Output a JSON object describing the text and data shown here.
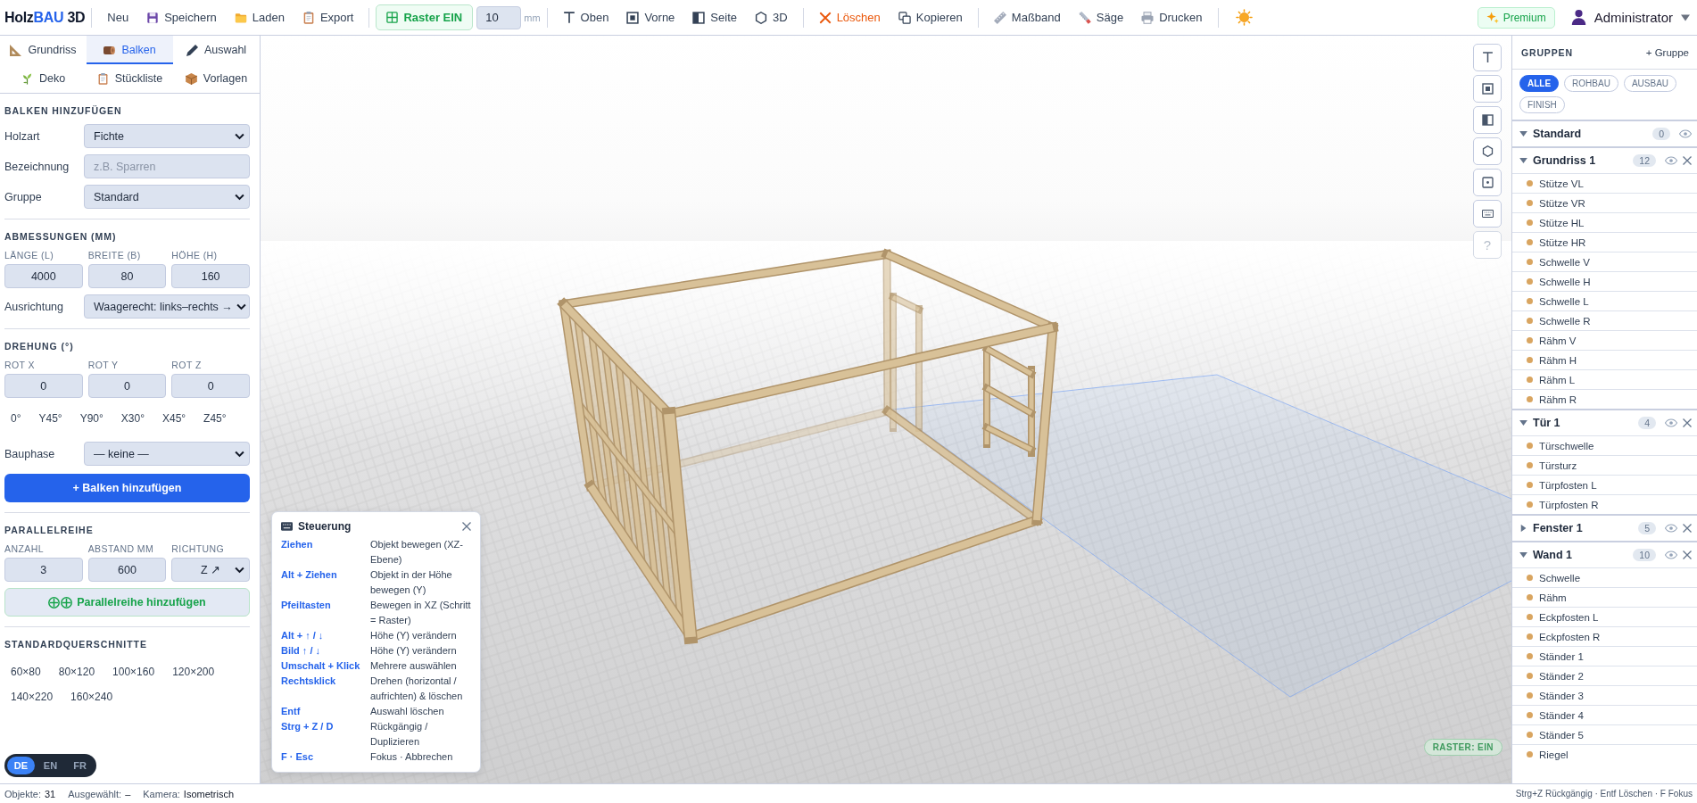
{
  "toolbar": {
    "logo": [
      {
        "text": "Holz",
        "kind": "plain"
      },
      {
        "text": "BAU",
        "kind": "accent"
      },
      {
        "text": " 3D",
        "kind": "plain"
      }
    ],
    "file_actions": [
      {
        "label": "Neu"
      },
      {
        "label": "Speichern"
      },
      {
        "label": "Laden"
      },
      {
        "label": "Export"
      }
    ],
    "grid": {
      "label": "Raster EIN",
      "on": true,
      "value": "10",
      "unit": "mm"
    },
    "views": [
      {
        "label": "Oben"
      },
      {
        "label": "Vorne"
      },
      {
        "label": "Seite"
      },
      {
        "label": "3D"
      }
    ],
    "edit_actions": [
      {
        "label": "Löschen",
        "kind": "danger"
      },
      {
        "label": "Kopieren",
        "kind": "normal"
      }
    ],
    "tools": [
      {
        "label": "Maßband"
      },
      {
        "label": "Säge"
      },
      {
        "label": "Drucken"
      }
    ],
    "premium": "Premium",
    "user": "Administrator"
  },
  "sidebar": {
    "tabs": [
      {
        "label": "Grundriss",
        "selected": false
      },
      {
        "label": "Balken",
        "selected": true
      },
      {
        "label": "Auswahl",
        "selected": false
      },
      {
        "label": "Deko",
        "selected": false
      },
      {
        "label": "Stückliste",
        "selected": false
      },
      {
        "label": "Vorlagen",
        "selected": false
      }
    ],
    "sections": [
      {
        "title": "BALKEN HINZUFÜGEN",
        "rows": [
          {
            "kind": "select",
            "label": "Holzart",
            "value": "Fichte"
          },
          {
            "kind": "text",
            "label": "Bezeichnung",
            "placeholder": "z.B. Sparren"
          },
          {
            "kind": "select",
            "label": "Gruppe",
            "value": "Standard"
          }
        ]
      },
      {
        "title": "ABMESSUNGEN (MM)",
        "rows": [
          {
            "kind": "triple",
            "fields": [
              {
                "label": "LÄNGE (L)",
                "kind": "number",
                "value": "4000"
              },
              {
                "label": "BREITE (B)",
                "kind": "number",
                "value": "80"
              },
              {
                "label": "HÖHE (H)",
                "kind": "number",
                "value": "160"
              }
            ]
          },
          {
            "kind": "select",
            "label": "Ausrichtung",
            "value": "Waagerecht: links–rechts →"
          }
        ]
      },
      {
        "title": "DREHUNG (°)",
        "rows": [
          {
            "kind": "triple",
            "fields": [
              {
                "label": "ROT X",
                "kind": "number",
                "value": "0"
              },
              {
                "label": "ROT Y",
                "kind": "number",
                "value": "0"
              },
              {
                "label": "ROT Z",
                "kind": "number",
                "value": "0"
              }
            ]
          },
          {
            "kind": "presets",
            "items": [
              "0°",
              "Y45°",
              "Y90°",
              "X30°",
              "X45°",
              "Z45°"
            ]
          },
          {
            "kind": "select",
            "label": "Bauphase",
            "value": "— keine —"
          },
          {
            "kind": "primary_button",
            "label": "+ Balken hinzufügen"
          }
        ]
      },
      {
        "title": "PARALLELREIHE",
        "rows": [
          {
            "kind": "triple",
            "fields": [
              {
                "label": "ANZAHL",
                "kind": "number",
                "value": "3"
              },
              {
                "label": "ABSTAND MM",
                "kind": "number",
                "value": "600"
              },
              {
                "label": "RICHTUNG",
                "kind": "select",
                "value": "Z ↗"
              }
            ]
          },
          {
            "kind": "secondary_button",
            "label": "Parallelreihe hinzufügen"
          }
        ]
      },
      {
        "title": "STANDARDQUERSCHNITTE",
        "rows": [
          {
            "kind": "presets",
            "items": [
              "60×80",
              "80×120",
              "100×160",
              "120×200",
              "140×220",
              "160×240"
            ]
          }
        ]
      }
    ],
    "languages": [
      {
        "label": "DE",
        "selected": true
      },
      {
        "label": "EN",
        "selected": false
      },
      {
        "label": "FR",
        "selected": false
      }
    ]
  },
  "scene": {
    "help_button": "?",
    "grid_badge": "RASTER: EIN",
    "controls_help": {
      "title": "Steuerung",
      "rows": [
        {
          "key": "Ziehen",
          "action": "Objekt bewegen (XZ-Ebene)"
        },
        {
          "key": "Alt + Ziehen",
          "action": "Objekt in der Höhe bewegen (Y)"
        },
        {
          "key": "Pfeiltasten",
          "action": "Bewegen in XZ (Schritt = Raster)"
        },
        {
          "key": "Alt + ↑ / ↓",
          "action": "Höhe (Y) verändern"
        },
        {
          "key": "Bild ↑ / ↓",
          "action": "Höhe (Y) verändern"
        },
        {
          "key": "Umschalt + Klick",
          "action": "Mehrere auswählen"
        },
        {
          "key": "Rechtsklick",
          "action": "Drehen (horizontal / aufrichten) & löschen"
        },
        {
          "key": "Entf",
          "action": "Auswahl löschen"
        },
        {
          "key": "Strg + Z / D",
          "action": "Rückgängig / Duplizieren"
        },
        {
          "key": "F · Esc",
          "action": "Fokus · Abbrechen"
        }
      ]
    }
  },
  "groups": {
    "title": "GRUPPEN",
    "add": "+ Gruppe",
    "filters": [
      {
        "label": "ALLE",
        "selected": true
      },
      {
        "label": "ROHBAU",
        "selected": false
      },
      {
        "label": "AUSBAU",
        "selected": false
      },
      {
        "label": "FINISH",
        "selected": false
      }
    ],
    "list": [
      {
        "name": "Standard",
        "count": "0",
        "expanded": true,
        "deletable": false
      },
      {
        "name": "Grundriss 1",
        "count": "12",
        "expanded": true,
        "deletable": true,
        "items": [
          "Stütze VL",
          "Stütze VR",
          "Stütze HL",
          "Stütze HR",
          "Schwelle V",
          "Schwelle H",
          "Schwelle L",
          "Schwelle R",
          "Rähm V",
          "Rähm H",
          "Rähm L",
          "Rähm R"
        ]
      },
      {
        "name": "Tür 1",
        "count": "4",
        "expanded": true,
        "deletable": true,
        "items": [
          "Türschwelle",
          "Türsturz",
          "Türpfosten L",
          "Türpfosten R"
        ]
      },
      {
        "name": "Fenster 1",
        "count": "5",
        "expanded": false,
        "deletable": true
      },
      {
        "name": "Wand 1",
        "count": "10",
        "expanded": true,
        "deletable": true,
        "items": [
          "Schwelle",
          "Rähm",
          "Eckpfosten L",
          "Eckpfosten R",
          "Ständer 1",
          "Ständer 2",
          "Ständer 3",
          "Ständer 4",
          "Ständer 5",
          "Riegel"
        ]
      }
    ]
  },
  "status_bar": {
    "stats": [
      {
        "label": "Objekte:",
        "value": "31"
      },
      {
        "label": "Ausgewählt:",
        "value": "–"
      },
      {
        "label": "Kamera:",
        "value": "Isometrisch"
      }
    ],
    "hints": "Strg+Z Rückgängig · Entf Löschen · F Fokus"
  }
}
